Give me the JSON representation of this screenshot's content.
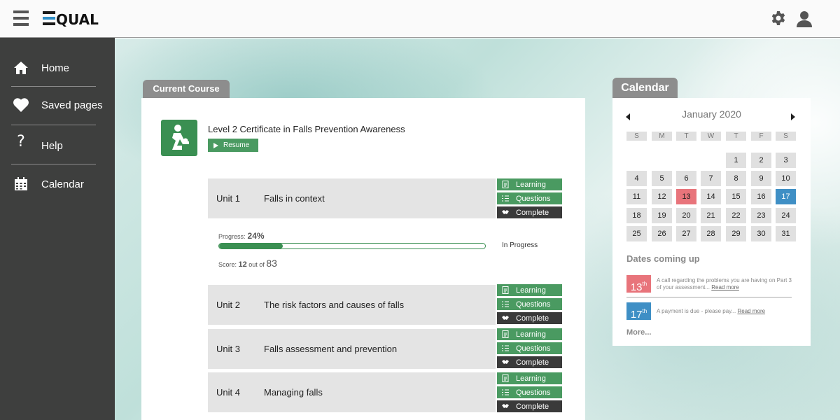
{
  "header": {
    "logo_text": "EQUAL"
  },
  "sidebar": {
    "items": [
      {
        "label": "Home",
        "icon": "home-icon"
      },
      {
        "label": "Saved pages",
        "icon": "heart-icon"
      },
      {
        "label": "Help",
        "icon": "question-icon"
      },
      {
        "label": "Calendar",
        "icon": "calendar-icon"
      }
    ]
  },
  "course": {
    "tab_label": "Current Course",
    "title": "Level 2 Certificate in Falls Prevention Awareness",
    "resume_label": "Resume",
    "progress_label": "Progress:",
    "progress_value": "24%",
    "progress_fraction": 0.24,
    "status": "In Progress",
    "score_label": "Score:",
    "score_value": "12",
    "score_out_of": "out of",
    "score_max": "83",
    "actions": {
      "learning": "Learning",
      "questions": "Questions",
      "complete": "Complete"
    },
    "units": [
      {
        "number": "Unit 1",
        "name": "Falls in context"
      },
      {
        "number": "Unit 2",
        "name": "The risk factors and causes of falls"
      },
      {
        "number": "Unit 3",
        "name": "Falls assessment and prevention"
      },
      {
        "number": "Unit 4",
        "name": "Managing falls"
      }
    ]
  },
  "calendar": {
    "tab_label": "Calendar",
    "month": "January 2020",
    "weekdays": [
      "S",
      "M",
      "T",
      "W",
      "T",
      "F",
      "S"
    ],
    "days": [
      "1",
      "2",
      "3",
      "4",
      "5",
      "6",
      "7",
      "8",
      "9",
      "10",
      "11",
      "12",
      "13",
      "14",
      "15",
      "16",
      "17",
      "18",
      "19",
      "20",
      "21",
      "22",
      "23",
      "24",
      "25",
      "26",
      "27",
      "28",
      "29",
      "30",
      "31"
    ],
    "first_weekday_index": 4,
    "highlight_red": "13",
    "highlight_blue": "17",
    "dates_heading": "Dates coming up",
    "events": [
      {
        "day": "13",
        "suffix": "th",
        "color": "red",
        "text": "A call regarding the problems you are having on Part 3 of your assessment...",
        "link": "Read more"
      },
      {
        "day": "17",
        "suffix": "th",
        "color": "blue",
        "text": "A payment is due - please pay...",
        "link": "Read more"
      }
    ],
    "more_label": "More..."
  },
  "colors": {
    "green": "#4a9a61",
    "dark_button": "#3a3a3a",
    "sidebar": "#3e3f3e",
    "red": "#e8747b",
    "blue": "#3f8fc5"
  }
}
